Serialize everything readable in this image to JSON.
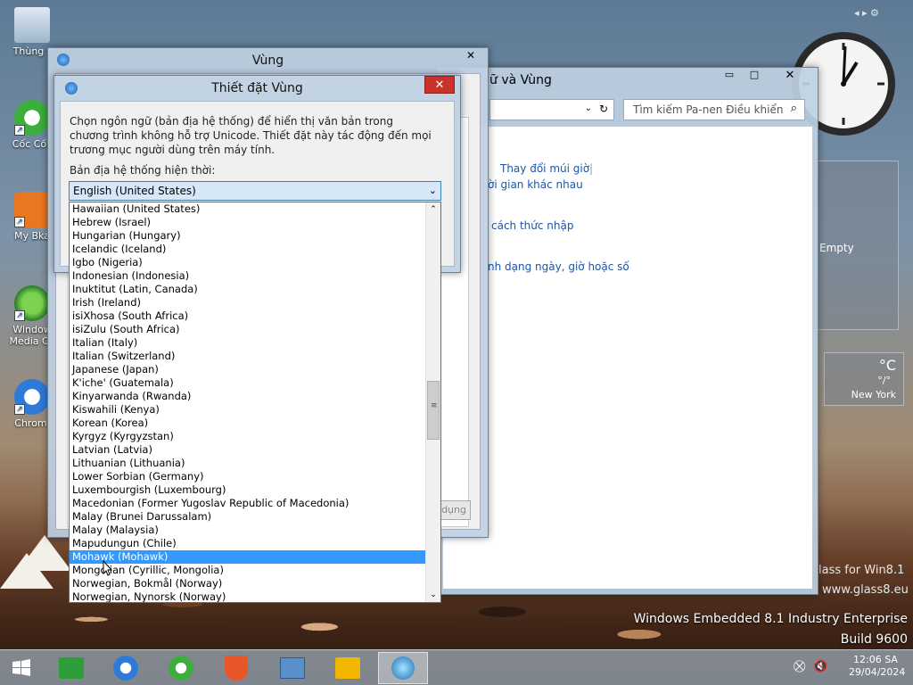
{
  "desktop_icons": [
    {
      "label": "Thùng r"
    },
    {
      "label": "Cốc Cốc"
    },
    {
      "label": "My Bka"
    },
    {
      "label": "Window Media Ce"
    },
    {
      "label": "Chromi"
    }
  ],
  "vung_window": {
    "title": "Vùng",
    "close": "✕"
  },
  "cp_window": {
    "title": "ữ và Vùng",
    "search_placeholder": "Tìm kiếm Pa-nen Điều khiển",
    "links": [
      "Thay đổi múi giờ",
      "ời gian khác nhau",
      "cách thức nhập",
      "nh dạng ngày, giờ hoặc số"
    ],
    "apply_button": "dụng",
    "minimize": "▭",
    "maximize": "□",
    "close": "✕"
  },
  "dialog": {
    "title": "Thiết đặt Vùng",
    "close": "✕",
    "description": "Chọn ngôn ngữ (bản địa hệ thống) để hiển thị văn bản trong chương trình không hỗ trợ Unicode. Thiết đặt này tác động đến mọi trương mục người dùng trên máy tính.",
    "locale_label": "Bản địa hệ thống hiện thời:",
    "selected_locale": "English (United States)",
    "options": [
      "Hawaiian (United States)",
      "Hebrew (Israel)",
      "Hungarian (Hungary)",
      "Icelandic (Iceland)",
      "Igbo (Nigeria)",
      "Indonesian (Indonesia)",
      "Inuktitut (Latin, Canada)",
      "Irish (Ireland)",
      "isiXhosa (South Africa)",
      "isiZulu (South Africa)",
      "Italian (Italy)",
      "Italian (Switzerland)",
      "Japanese (Japan)",
      "K'iche' (Guatemala)",
      "Kinyarwanda (Rwanda)",
      "Kiswahili (Kenya)",
      "Korean (Korea)",
      "Kyrgyz (Kyrgyzstan)",
      "Latvian (Latvia)",
      "Lithuanian (Lithuania)",
      "Lower Sorbian (Germany)",
      "Luxembourgish (Luxembourg)",
      "Macedonian (Former Yugoslav Republic of Macedonia)",
      "Malay (Brunei Darussalam)",
      "Malay (Malaysia)",
      "Mapudungun (Chile)",
      "Mohawk (Mohawk)",
      "Mongolian (Cyrillic, Mongolia)",
      "Norwegian, Bokmål (Norway)",
      "Norwegian, Nynorsk (Norway)"
    ],
    "highlighted_index": 26
  },
  "gadgets": {
    "recycle_status": "Empty",
    "weather_unit": "°C",
    "weather_range": "°/°",
    "weather_city": "New York"
  },
  "watermark": {
    "glass1": "lass for Win8.1",
    "glass2": "www.glass8.eu",
    "edition": "Windows Embedded 8.1 Industry Enterprise",
    "build": "Build 9600"
  },
  "tray": {
    "time": "12:06 SA",
    "date": "29/04/2024"
  },
  "colors": {
    "selection": "#3399ff",
    "close_red": "#c8332c",
    "link": "#1f56a5"
  }
}
